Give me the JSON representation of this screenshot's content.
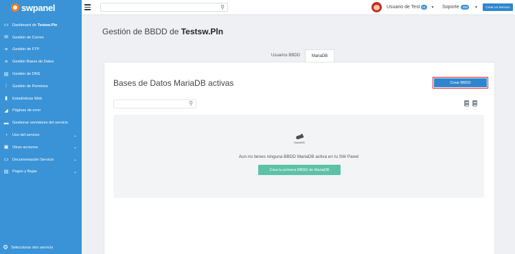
{
  "brand": {
    "name": "swpanel"
  },
  "sidebar": {
    "items": [
      {
        "label": "Dashboard de ",
        "bold": "Testsw.Pln",
        "icon": "dashboard-icon",
        "glyph": "▭"
      },
      {
        "label": "Gestión de Correo",
        "icon": "mail-icon",
        "glyph": "✉"
      },
      {
        "label": "Gestión de FTP",
        "icon": "ftp-icon",
        "glyph": "≡"
      },
      {
        "label": "Gestión Bases de Datos",
        "icon": "database-icon",
        "glyph": "≡"
      },
      {
        "label": "Gestión de DNS",
        "icon": "dns-icon",
        "glyph": "▤"
      },
      {
        "label": "Gestión de Permisos",
        "icon": "permissions-icon",
        "glyph": "⁞"
      },
      {
        "label": "Estadísticas Web",
        "icon": "stats-icon",
        "glyph": "▮"
      },
      {
        "label": "Páginas de error",
        "icon": "error-pages-icon",
        "glyph": "◢"
      },
      {
        "label": "Gestionar servidores del servicio",
        "icon": "servers-icon",
        "glyph": "▬"
      },
      {
        "label": "Uso del servicio",
        "icon": "usage-icon",
        "glyph": "◔",
        "chevron": "⌄"
      },
      {
        "label": "Otras acciones",
        "icon": "actions-icon",
        "glyph": "▣",
        "chevron": "⌄"
      },
      {
        "label": "Documentación Servicio",
        "icon": "docs-icon",
        "glyph": "▭",
        "chevron": "⌄"
      },
      {
        "label": "Pagos y Bajas",
        "icon": "payments-icon",
        "glyph": "▤",
        "chevron": "⌄"
      }
    ],
    "bottom_label": "Seleccionar otro servicio"
  },
  "topbar": {
    "user_label": "Usuario de Test",
    "user_badge": "16",
    "support_label": "Soporte",
    "support_badge": "200",
    "create_service_label": "Crear un Servicio"
  },
  "page": {
    "title_prefix": "Gestión de BBDD de ",
    "title_bold": "Testsw.Pln",
    "tabs": [
      {
        "label": "Usuarios BBDD",
        "active": false
      },
      {
        "label": "MariaDB",
        "active": true
      }
    ]
  },
  "panel": {
    "title": "Bases de Datos MariaDB activas",
    "create_button": "Crear BBDD",
    "logo_text": "MariaDB",
    "empty_message": "Aun no tienes ninguna BBDD MariaDB activa en tu SW Panel",
    "first_button": "Crea tu primera BBDD de MariaDB"
  },
  "colors": {
    "sidebar": "#3a93d6",
    "primary_button": "#2f86cf",
    "highlight_border": "#e02020",
    "secondary_button": "#5cc2a6"
  }
}
